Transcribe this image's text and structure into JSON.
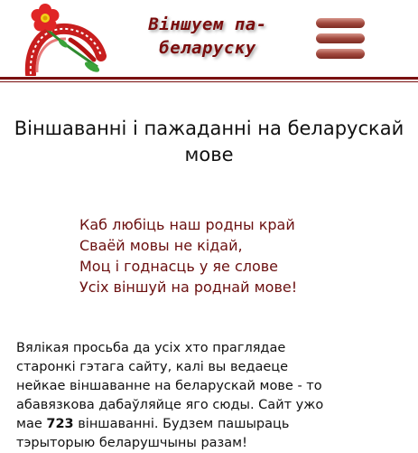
{
  "header": {
    "site_title_line1": "Віншуем па-",
    "site_title_line2": "беларуску",
    "logo_icon": "flower-ribbon-logo-icon",
    "menu_icon": "hamburger-menu-icon",
    "accent_color": "#7a1010"
  },
  "main": {
    "heading": "Віншаванні і пажаданні на беларускай мове",
    "poem": [
      "Каб любіць наш родны край",
      "Сваёй мовы не кідай,",
      "Моц і годнасць у яе слове",
      "Усіх віншуй на роднай мове!"
    ],
    "request": {
      "text_before": "Вялікая просьба да усіх хто праглядае старонкі гэтага сайту, калі вы ведаеце нейкае віншаванне на беларускай мове - то абавязкова дабаўляйце яго сюды. Сайт ужо мае ",
      "count": "723",
      "text_after": " віншаванні. Будзем пашыраць тэрыторыю беларушчыны разам!"
    }
  }
}
